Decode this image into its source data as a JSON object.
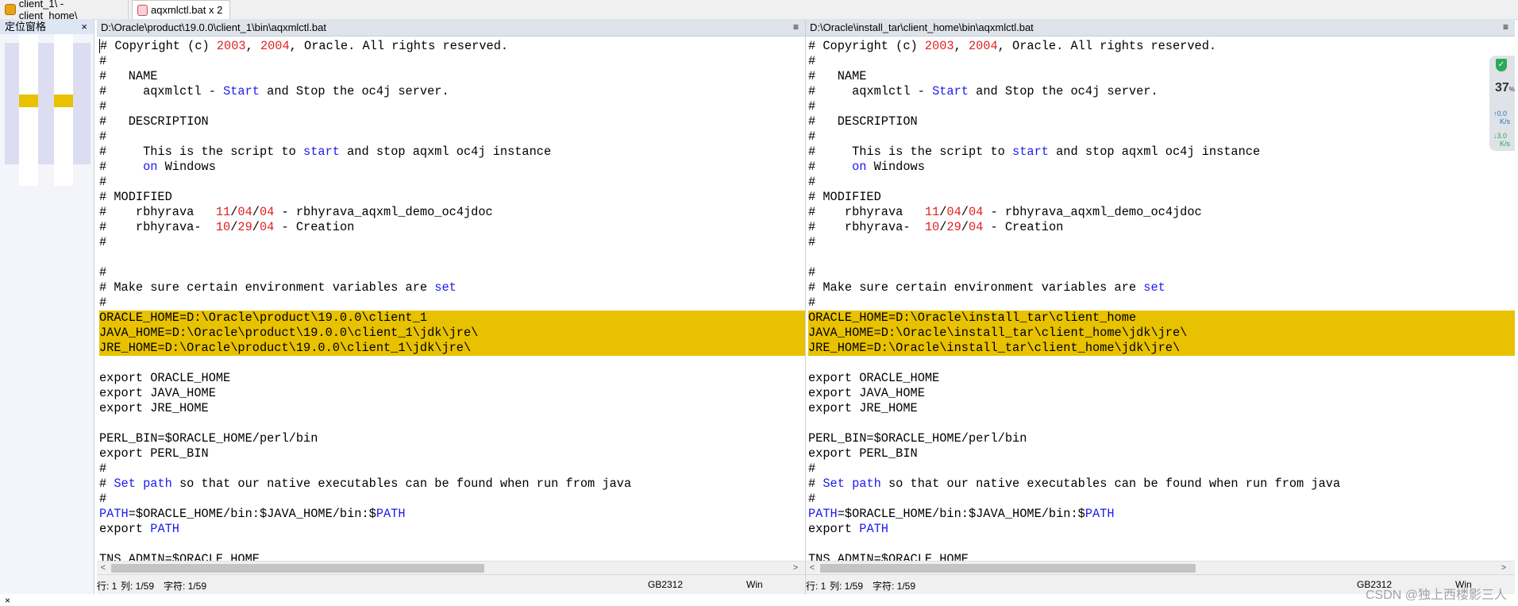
{
  "tabs": [
    {
      "label": "client_1\\ - client_home\\",
      "icon": "compare-folder-icon"
    },
    {
      "label": "aqxmlctl.bat x 2",
      "icon": "file-compare-icon"
    }
  ],
  "location_pane": {
    "title": "定位窗格",
    "close": "×"
  },
  "left": {
    "path": "D:\\Oracle\\product\\19.0.0\\client_1\\bin\\aqxmlctl.bat",
    "menu": "≡",
    "status": {
      "row": "行: 1",
      "col": "列: 1/59",
      "chars": "字符: 1/59",
      "encoding": "GB2312",
      "eol": "Win"
    }
  },
  "right": {
    "path": "D:\\Oracle\\install_tar\\client_home\\bin\\aqxmlctl.bat",
    "menu": "≡",
    "status": {
      "row": "行: 1",
      "col": "列: 1/59",
      "chars": "字符: 1/59",
      "encoding": "GB2312",
      "eol": "Win"
    }
  },
  "code_common_top": [
    "# Copyright (c) 2003, 2004, Oracle. All rights reserved.",
    "#",
    "#   NAME",
    "#     aqxmlctl - Start and Stop the oc4j server.",
    "#",
    "#   DESCRIPTION",
    "#",
    "#     This is the script to start and stop aqxml oc4j instance",
    "#     on Windows",
    "#",
    "# MODIFIED",
    "#    rbhyrava   11/04/04 - rbhyrava_aqxml_demo_oc4jdoc",
    "#    rbhyrava-  10/29/04 - Creation",
    "#",
    "",
    "#",
    "# Make sure certain environment variables are set",
    "#"
  ],
  "code_left_diff": [
    "ORACLE_HOME=D:\\Oracle\\product\\19.0.0\\client_1",
    "JAVA_HOME=D:\\Oracle\\product\\19.0.0\\client_1\\jdk\\jre\\",
    "JRE_HOME=D:\\Oracle\\product\\19.0.0\\client_1\\jdk\\jre\\"
  ],
  "code_right_diff": [
    "ORACLE_HOME=D:\\Oracle\\install_tar\\client_home",
    "JAVA_HOME=D:\\Oracle\\install_tar\\client_home\\jdk\\jre\\",
    "JRE_HOME=D:\\Oracle\\install_tar\\client_home\\jdk\\jre\\"
  ],
  "code_common_bottom": [
    "",
    "export ORACLE_HOME",
    "export JAVA_HOME",
    "export JRE_HOME",
    "",
    "PERL_BIN=$ORACLE_HOME/perl/bin",
    "export PERL_BIN",
    "#",
    "# Set path so that our native executables can be found when run from java",
    "#",
    "PATH=$ORACLE_HOME/bin:$JAVA_HOME/bin:$PATH",
    "export PATH",
    "",
    "TNS_ADMIN=$ORACLE_HOME"
  ],
  "keywords": [
    "Start",
    "start",
    "on",
    "set",
    "Set",
    "path",
    "PATH"
  ],
  "widget": {
    "percent": "37",
    "percent_unit": "%",
    "up": "0.0",
    "down": "3.0",
    "rate_unit": "K/s"
  },
  "watermark": "CSDN @独上西楼影三人",
  "colors": {
    "diff_highlight": "#e8c200",
    "keyword": "#1a1af0",
    "number": "#e02020"
  }
}
